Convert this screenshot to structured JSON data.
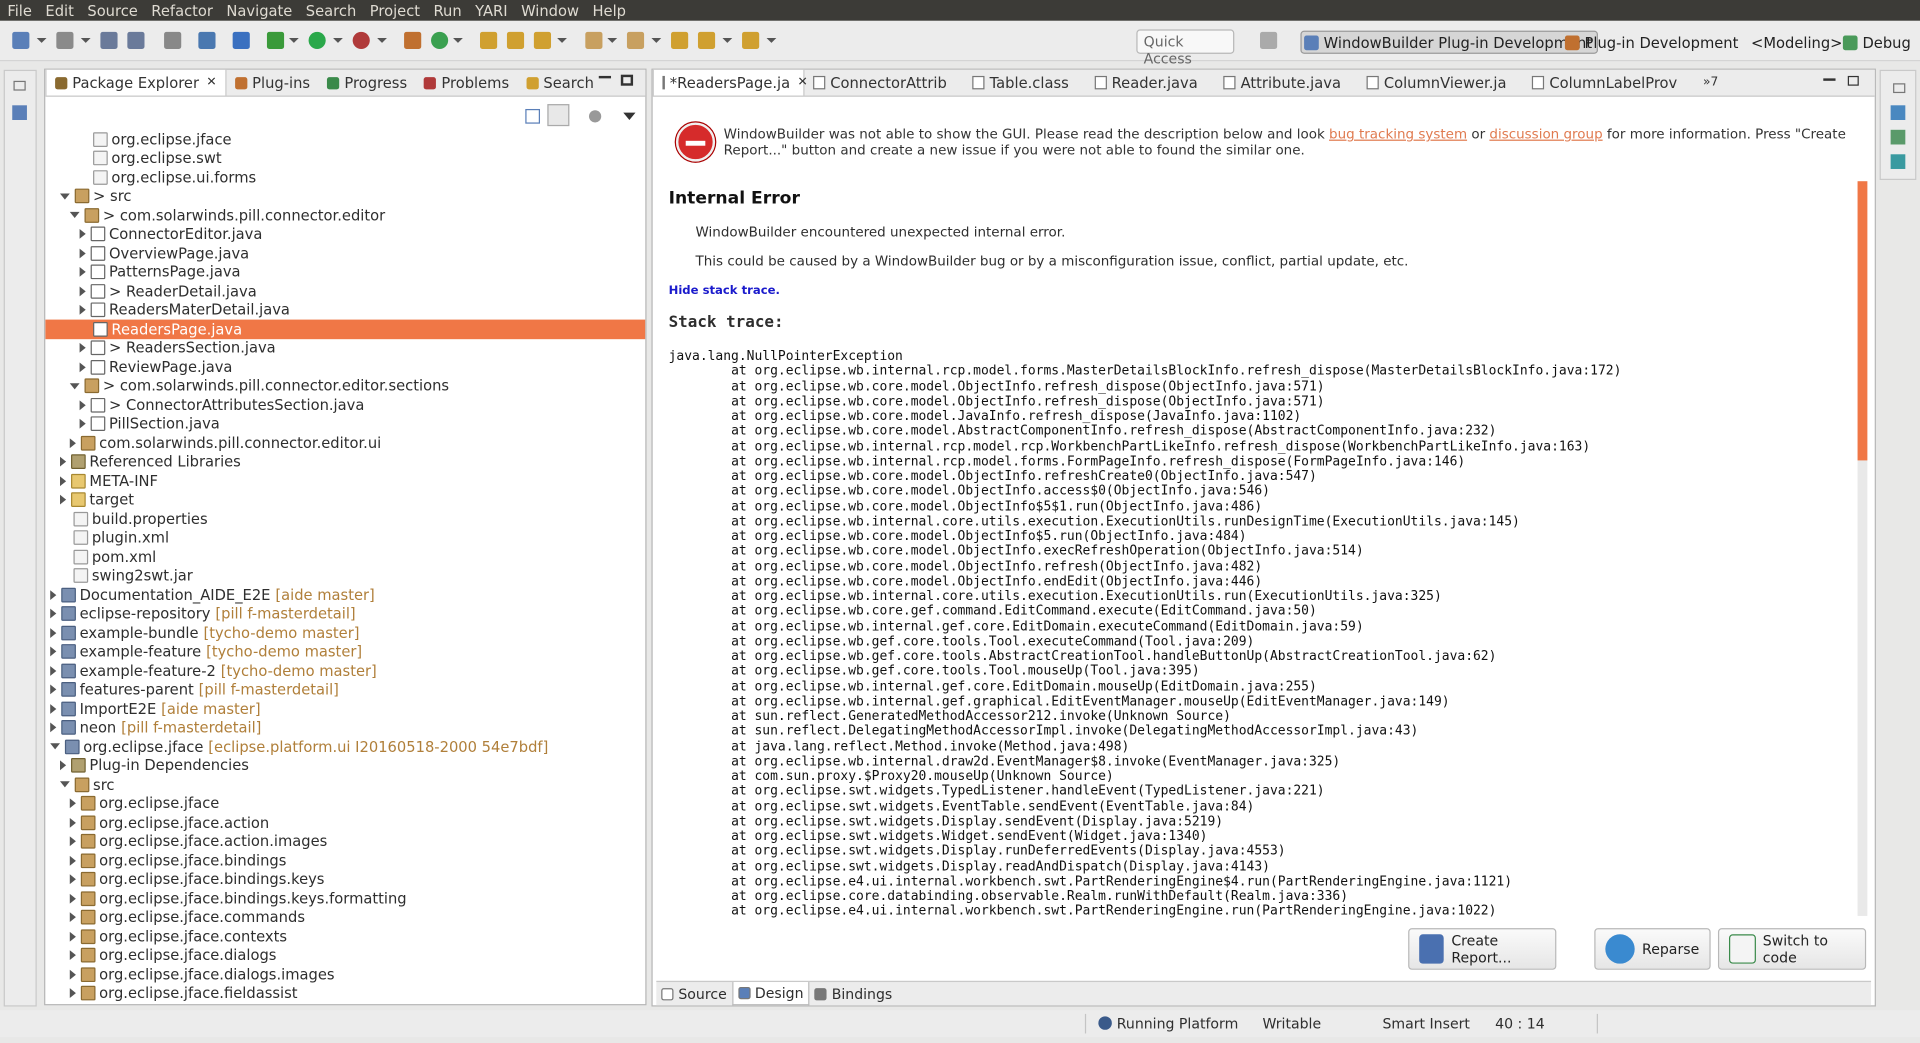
{
  "menu": [
    "File",
    "Edit",
    "Source",
    "Refactor",
    "Navigate",
    "Search",
    "Project",
    "Run",
    "YARI",
    "Window",
    "Help"
  ],
  "quick_access": "Quick Access",
  "perspectives": [
    {
      "label": "WindowBuilder Plug-in Development",
      "active": true
    },
    {
      "label": "Plug-in Development",
      "active": false
    },
    {
      "label": "<Modeling>",
      "active": false
    },
    {
      "label": "Debug",
      "active": false
    }
  ],
  "left_tabs": [
    "Package Explorer",
    "Plug-ins",
    "Progress",
    "Problems",
    "Search"
  ],
  "tree": [
    {
      "t": "org.eclipse.jface",
      "d": 3,
      "i": "file",
      "tw": ""
    },
    {
      "t": "org.eclipse.swt",
      "d": 3,
      "i": "file",
      "tw": ""
    },
    {
      "t": "org.eclipse.ui.forms",
      "d": 3,
      "i": "file",
      "tw": ""
    },
    {
      "t": "> src",
      "d": 1,
      "i": "pkg",
      "tw": "o"
    },
    {
      "t": "> com.solarwinds.pill.connector.editor",
      "d": 2,
      "i": "pkg",
      "tw": "o"
    },
    {
      "t": "ConnectorEditor.java",
      "d": 3,
      "i": "java",
      "tw": "c"
    },
    {
      "t": "OverviewPage.java",
      "d": 3,
      "i": "java",
      "tw": "c"
    },
    {
      "t": "PatternsPage.java",
      "d": 3,
      "i": "java",
      "tw": "c"
    },
    {
      "t": "> ReaderDetail.java",
      "d": 3,
      "i": "java",
      "tw": "c"
    },
    {
      "t": "ReadersMaterDetail.java",
      "d": 3,
      "i": "java",
      "tw": "c"
    },
    {
      "t": "ReadersPage.java",
      "d": 3,
      "i": "java",
      "tw": "",
      "sel": true
    },
    {
      "t": "> ReadersSection.java",
      "d": 3,
      "i": "java",
      "tw": "c"
    },
    {
      "t": "ReviewPage.java",
      "d": 3,
      "i": "java",
      "tw": "c"
    },
    {
      "t": "> com.solarwinds.pill.connector.editor.sections",
      "d": 2,
      "i": "pkg",
      "tw": "o"
    },
    {
      "t": "> ConnectorAttributesSection.java",
      "d": 3,
      "i": "java",
      "tw": "c"
    },
    {
      "t": "PillSection.java",
      "d": 3,
      "i": "java",
      "tw": "c"
    },
    {
      "t": "com.solarwinds.pill.connector.editor.ui",
      "d": 2,
      "i": "pkg",
      "tw": "c"
    },
    {
      "t": "Referenced Libraries",
      "d": 1,
      "i": "lib",
      "tw": "c"
    },
    {
      "t": "META-INF",
      "d": 1,
      "i": "fold",
      "tw": "c"
    },
    {
      "t": "target",
      "d": 1,
      "i": "fold",
      "tw": "c"
    },
    {
      "t": "build.properties",
      "d": 1,
      "i": "file",
      "tw": ""
    },
    {
      "t": "plugin.xml",
      "d": 1,
      "i": "file",
      "tw": ""
    },
    {
      "t": "pom.xml",
      "d": 1,
      "i": "file",
      "tw": ""
    },
    {
      "t": "swing2swt.jar",
      "d": 1,
      "i": "file",
      "tw": ""
    },
    {
      "t": "Documentation_AIDE_E2E",
      "dec": "[aide master]",
      "d": 0,
      "i": "proj",
      "tw": "c"
    },
    {
      "t": "eclipse-repository",
      "dec": "[pill f-masterdetail]",
      "d": 0,
      "i": "proj",
      "tw": "c"
    },
    {
      "t": "example-bundle",
      "dec": "[tycho-demo master]",
      "d": 0,
      "i": "proj",
      "tw": "c"
    },
    {
      "t": "example-feature",
      "dec": "[tycho-demo master]",
      "d": 0,
      "i": "proj",
      "tw": "c"
    },
    {
      "t": "example-feature-2",
      "dec": "[tycho-demo master]",
      "d": 0,
      "i": "proj",
      "tw": "c"
    },
    {
      "t": "features-parent",
      "dec": "[pill f-masterdetail]",
      "d": 0,
      "i": "proj",
      "tw": "c"
    },
    {
      "t": "ImportE2E",
      "dec": "[aide master]",
      "d": 0,
      "i": "proj",
      "tw": "c"
    },
    {
      "t": "neon",
      "dec": "[pill f-masterdetail]",
      "d": 0,
      "i": "proj",
      "tw": "c"
    },
    {
      "t": "org.eclipse.jface",
      "dec": "[eclipse.platform.ui I20160518-2000 54e7bdf]",
      "d": 0,
      "i": "proj",
      "tw": "o"
    },
    {
      "t": "Plug-in Dependencies",
      "d": 1,
      "i": "lib",
      "tw": "c"
    },
    {
      "t": "src",
      "d": 1,
      "i": "pkg",
      "tw": "o"
    },
    {
      "t": "org.eclipse.jface",
      "d": 2,
      "i": "pkg",
      "tw": "c"
    },
    {
      "t": "org.eclipse.jface.action",
      "d": 2,
      "i": "pkg",
      "tw": "c"
    },
    {
      "t": "org.eclipse.jface.action.images",
      "d": 2,
      "i": "pkg",
      "tw": "c"
    },
    {
      "t": "org.eclipse.jface.bindings",
      "d": 2,
      "i": "pkg",
      "tw": "c"
    },
    {
      "t": "org.eclipse.jface.bindings.keys",
      "d": 2,
      "i": "pkg",
      "tw": "c"
    },
    {
      "t": "org.eclipse.jface.bindings.keys.formatting",
      "d": 2,
      "i": "pkg",
      "tw": "c"
    },
    {
      "t": "org.eclipse.jface.commands",
      "d": 2,
      "i": "pkg",
      "tw": "c"
    },
    {
      "t": "org.eclipse.jface.contexts",
      "d": 2,
      "i": "pkg",
      "tw": "c"
    },
    {
      "t": "org.eclipse.jface.dialogs",
      "d": 2,
      "i": "pkg",
      "tw": "c"
    },
    {
      "t": "org.eclipse.jface.dialogs.images",
      "d": 2,
      "i": "pkg",
      "tw": "c"
    },
    {
      "t": "org.eclipse.jface.fieldassist",
      "d": 2,
      "i": "pkg",
      "tw": "c"
    }
  ],
  "editor_tabs": [
    "*ReadersPage.ja",
    "ConnectorAttrib",
    "Table.class",
    "Reader.java",
    "Attribute.java",
    "ColumnViewer.ja",
    "ColumnLabelProv"
  ],
  "overflow_count": "»7",
  "error": {
    "msg1": "WindowBuilder was not able to show the GUI. Please read the description below and look ",
    "link1": "bug tracking system",
    "or": " or ",
    "link2": "discussion group",
    "msg2": " for more information. Press \"Create Report...\" button and create a new issue if you were not able to found the similar one."
  },
  "internal_error": "Internal Error",
  "p1": "WindowBuilder encountered unexpected internal error.",
  "p2": "This could be caused by a WindowBuilder bug or by a misconfiguration issue, conflict, partial update, etc.",
  "hide_trace": "Hide stack trace.",
  "stack_title": "Stack trace:",
  "trace": [
    "java.lang.NullPointerException",
    "\tat org.eclipse.wb.internal.rcp.model.forms.MasterDetailsBlockInfo.refresh_dispose(MasterDetailsBlockInfo.java:172)",
    "\tat org.eclipse.wb.core.model.ObjectInfo.refresh_dispose(ObjectInfo.java:571)",
    "\tat org.eclipse.wb.core.model.ObjectInfo.refresh_dispose(ObjectInfo.java:571)",
    "\tat org.eclipse.wb.core.model.JavaInfo.refresh_dispose(JavaInfo.java:1102)",
    "\tat org.eclipse.wb.core.model.AbstractComponentInfo.refresh_dispose(AbstractComponentInfo.java:232)",
    "\tat org.eclipse.wb.internal.rcp.model.rcp.WorkbenchPartLikeInfo.refresh_dispose(WorkbenchPartLikeInfo.java:163)",
    "\tat org.eclipse.wb.internal.rcp.model.forms.FormPageInfo.refresh_dispose(FormPageInfo.java:146)",
    "\tat org.eclipse.wb.core.model.ObjectInfo.refreshCreate0(ObjectInfo.java:547)",
    "\tat org.eclipse.wb.core.model.ObjectInfo.access$0(ObjectInfo.java:546)",
    "\tat org.eclipse.wb.core.model.ObjectInfo$5$1.run(ObjectInfo.java:486)",
    "\tat org.eclipse.wb.internal.core.utils.execution.ExecutionUtils.runDesignTime(ExecutionUtils.java:145)",
    "\tat org.eclipse.wb.core.model.ObjectInfo$5.run(ObjectInfo.java:484)",
    "\tat org.eclipse.wb.core.model.ObjectInfo.execRefreshOperation(ObjectInfo.java:514)",
    "\tat org.eclipse.wb.core.model.ObjectInfo.refresh(ObjectInfo.java:482)",
    "\tat org.eclipse.wb.core.model.ObjectInfo.endEdit(ObjectInfo.java:446)",
    "\tat org.eclipse.wb.internal.core.utils.execution.ExecutionUtils.run(ExecutionUtils.java:325)",
    "\tat org.eclipse.wb.core.gef.command.EditCommand.execute(EditCommand.java:50)",
    "\tat org.eclipse.wb.internal.gef.core.EditDomain.executeCommand(EditDomain.java:59)",
    "\tat org.eclipse.wb.gef.core.tools.Tool.executeCommand(Tool.java:209)",
    "\tat org.eclipse.wb.gef.core.tools.AbstractCreationTool.handleButtonUp(AbstractCreationTool.java:62)",
    "\tat org.eclipse.wb.gef.core.tools.Tool.mouseUp(Tool.java:395)",
    "\tat org.eclipse.wb.internal.gef.core.EditDomain.mouseUp(EditDomain.java:255)",
    "\tat org.eclipse.wb.internal.gef.graphical.EditEventManager.mouseUp(EditEventManager.java:149)",
    "\tat sun.reflect.GeneratedMethodAccessor212.invoke(Unknown Source)",
    "\tat sun.reflect.DelegatingMethodAccessorImpl.invoke(DelegatingMethodAccessorImpl.java:43)",
    "\tat java.lang.reflect.Method.invoke(Method.java:498)",
    "\tat org.eclipse.wb.internal.draw2d.EventManager$8.invoke(EventManager.java:325)",
    "\tat com.sun.proxy.$Proxy20.mouseUp(Unknown Source)",
    "\tat org.eclipse.swt.widgets.TypedListener.handleEvent(TypedListener.java:221)",
    "\tat org.eclipse.swt.widgets.EventTable.sendEvent(EventTable.java:84)",
    "\tat org.eclipse.swt.widgets.Display.sendEvent(Display.java:5219)",
    "\tat org.eclipse.swt.widgets.Widget.sendEvent(Widget.java:1340)",
    "\tat org.eclipse.swt.widgets.Display.runDeferredEvents(Display.java:4553)",
    "\tat org.eclipse.swt.widgets.Display.readAndDispatch(Display.java:4143)",
    "\tat org.eclipse.e4.ui.internal.workbench.swt.PartRenderingEngine$4.run(PartRenderingEngine.java:1121)",
    "\tat org.eclipse.core.databinding.observable.Realm.runWithDefault(Realm.java:336)",
    "\tat org.eclipse.e4.ui.internal.workbench.swt.PartRenderingEngine.run(PartRenderingEngine.java:1022)"
  ],
  "buttons": {
    "create_report": "Create Report...",
    "reparse": "Reparse",
    "switch_code": "Switch to code"
  },
  "bottom_tabs": [
    "Source",
    "Design",
    "Bindings"
  ],
  "status": {
    "running": "Running Platform",
    "writable": "Writable",
    "insert": "Smart Insert",
    "pos": "40 : 14"
  }
}
